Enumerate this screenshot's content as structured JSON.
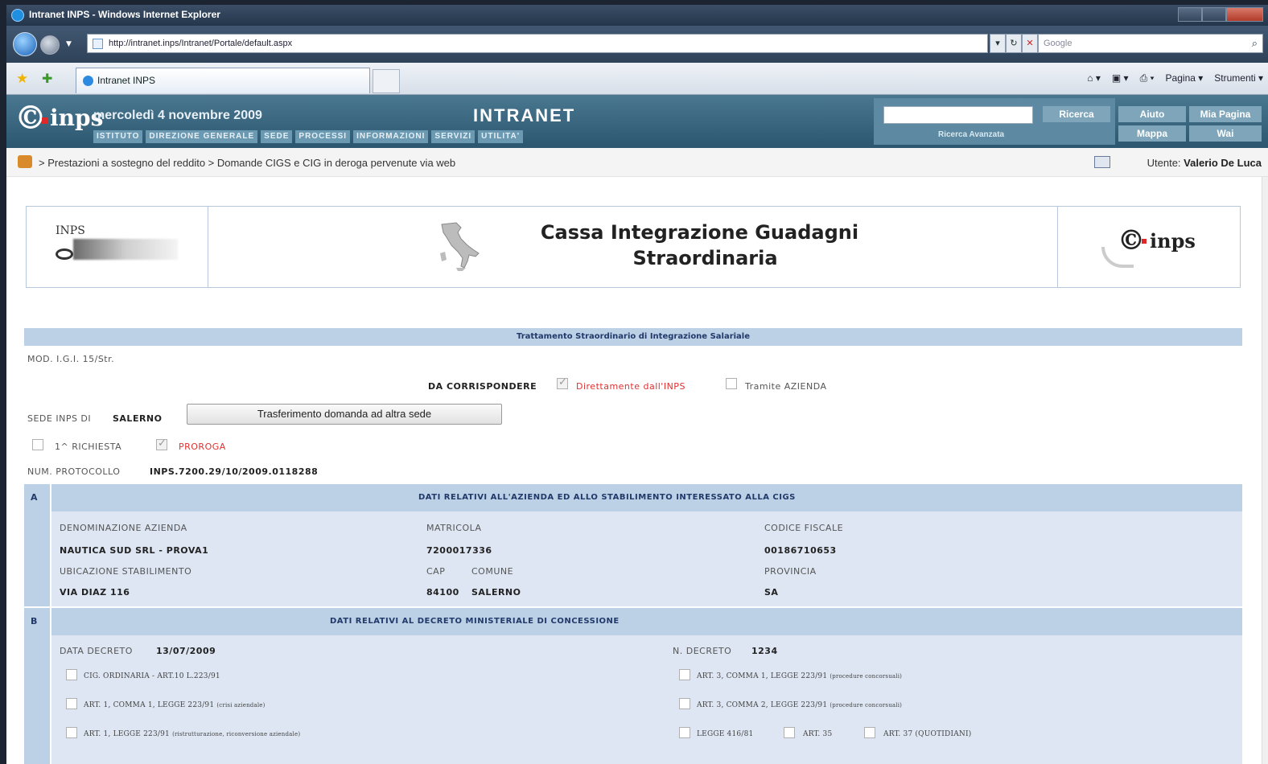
{
  "browser": {
    "title": "Intranet INPS - Windows Internet Explorer",
    "url": "http://intranet.inps/Intranet/Portale/default.aspx",
    "search_placeholder": "Google",
    "tab_label": "Intranet INPS",
    "cmd_page": "Pagina ▾",
    "cmd_tools": "Strumenti ▾"
  },
  "header": {
    "date": "mercoledì 4 novembre 2009",
    "title": "INTRANET",
    "menu": [
      "ISTITUTO",
      "DIREZIONE GENERALE",
      "SEDE",
      "PROCESSI",
      "INFORMAZIONI",
      "SERVIZI",
      "UTILITA'"
    ],
    "search_button": "Ricerca",
    "advanced_search": "Ricerca Avanzata",
    "help": "Aiuto",
    "my_page": "Mia Pagina",
    "map": "Mappa",
    "wai": "Wai"
  },
  "breadcrumb": {
    "path": "> Prestazioni a sostegno del reddito > Domande CIGS e CIG in deroga pervenute via web",
    "user_label": "Utente:",
    "user_name": "Valerio De Luca"
  },
  "page": {
    "title_line1": "Cassa Integrazione Guadagni",
    "title_line2": "Straordinaria",
    "inps_logo_text": "INPS",
    "section_header": "Trattamento Straordinario di Integrazione Salariale",
    "mod": "MOD. I.G.I. 15/Str.",
    "da_corrispondere": "DA CORRISPONDERE",
    "opt_direct": "Direttamente dall'INPS",
    "opt_company": "Tramite AZIENDA",
    "sede_label": "SEDE INPS DI",
    "sede_value": "SALERNO",
    "transfer_button": "Trasferimento domanda ad altra sede",
    "first_request": "1^ RICHIESTA",
    "extension": "PROROGA",
    "protocol_label": "NUM. PROTOCOLLO",
    "protocol_value": "INPS.7200.29/10/2009.0118288"
  },
  "section_a": {
    "letter": "A",
    "title": "DATI RELATIVI ALL'AZIENDA ED ALLO STABILIMENTO INTERESSATO ALLA CIGS",
    "lbl_name": "DENOMINAZIONE AZIENDA",
    "val_name": "NAUTICA SUD SRL - PROVA1",
    "lbl_matricola": "MATRICOLA",
    "val_matricola": "7200017336",
    "lbl_cf": "CODICE FISCALE",
    "val_cf": "00186710653",
    "lbl_site": "UBICAZIONE STABILIMENTO",
    "val_site": "VIA DIAZ 116",
    "lbl_cap": "CAP",
    "val_cap": "84100",
    "lbl_comune": "COMUNE",
    "val_comune": "SALERNO",
    "lbl_prov": "PROVINCIA",
    "val_prov": "SA"
  },
  "section_b": {
    "letter": "B",
    "title": "DATI RELATIVI AL DECRETO MINISTERIALE DI CONCESSIONE",
    "lbl_date": "DATA DECRETO",
    "val_date": "13/07/2009",
    "lbl_num": "N. DECRETO",
    "val_num": "1234",
    "opt1": "CIG. ORDINARIA - ART.10 L.223/91",
    "opt2": "ART. 1, COMMA 1, LEGGE 223/91",
    "opt2_sub": "(crisi aziendale)",
    "opt3": "ART. 1, LEGGE 223/91",
    "opt3_sub": "(ristrutturazione, riconversione aziendale)",
    "opt4": "ART. 3, COMMA 1, LEGGE 223/91",
    "opt4_sub": "(procedure concorsuali)",
    "opt5": "ART. 3, COMMA 2, LEGGE 223/91",
    "opt5_sub": "(procedure concorsuali)",
    "opt6": "LEGGE 416/81",
    "opt7": "ART. 35",
    "opt8": "ART. 37 (QUOTIDIANI)"
  }
}
